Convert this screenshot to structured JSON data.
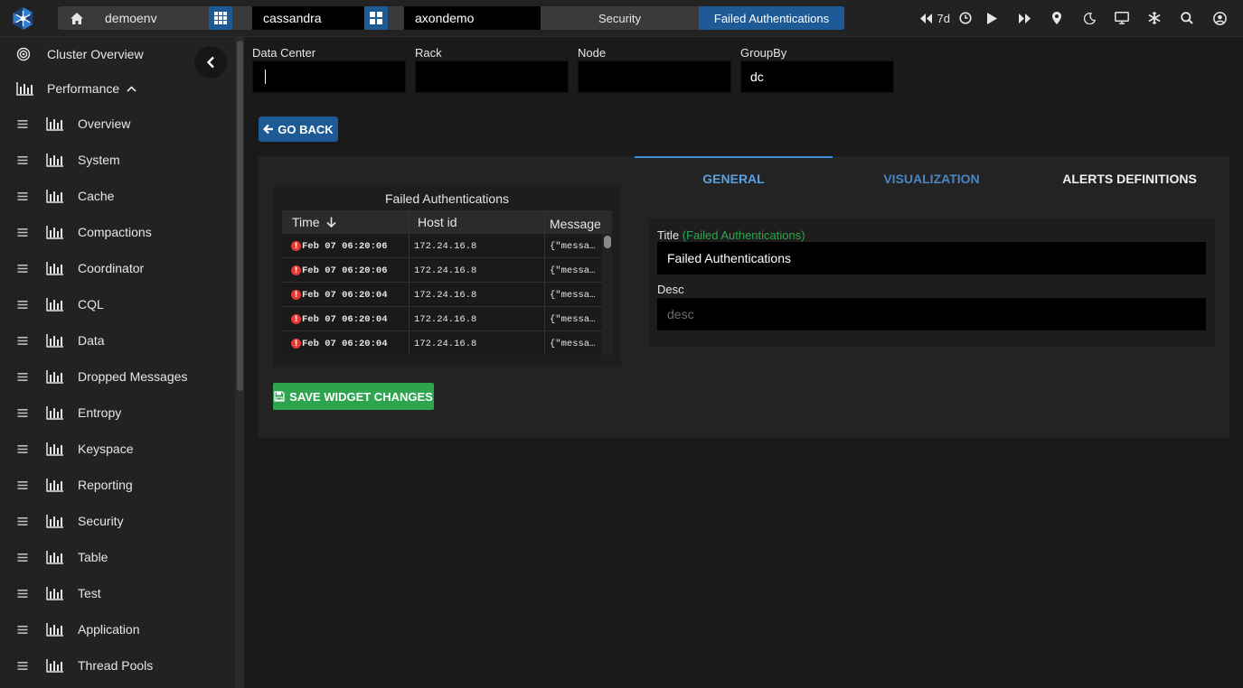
{
  "breadcrumb": {
    "env": "demoenv",
    "cluster": "cassandra",
    "org": "axondemo",
    "section": "Security",
    "active": "Failed Authentications"
  },
  "toolbar": {
    "range": "7d"
  },
  "sidebar": {
    "cluster_overview": "Cluster Overview",
    "performance": "Performance",
    "items": [
      {
        "label": "Overview"
      },
      {
        "label": "System"
      },
      {
        "label": "Cache"
      },
      {
        "label": "Compactions"
      },
      {
        "label": "Coordinator"
      },
      {
        "label": "CQL"
      },
      {
        "label": "Data"
      },
      {
        "label": "Dropped Messages"
      },
      {
        "label": "Entropy"
      },
      {
        "label": "Keyspace"
      },
      {
        "label": "Reporting"
      },
      {
        "label": "Security"
      },
      {
        "label": "Table"
      },
      {
        "label": "Test"
      },
      {
        "label": "Application"
      },
      {
        "label": "Thread Pools"
      }
    ]
  },
  "filters": {
    "data_center_label": "Data Center",
    "data_center_value": "",
    "rack_label": "Rack",
    "rack_value": "",
    "node_label": "Node",
    "node_value": "",
    "groupby_label": "GroupBy",
    "groupby_value": "dc"
  },
  "go_back_label": "GO BACK",
  "widget": {
    "title": "Failed Authentications",
    "columns": [
      "Time",
      "Host id",
      "Message"
    ],
    "rows": [
      {
        "time": "Feb 07 06:20:06",
        "host": "172.24.16.8",
        "message": "{\"messa…"
      },
      {
        "time": "Feb 07 06:20:06",
        "host": "172.24.16.8",
        "message": "{\"messa…"
      },
      {
        "time": "Feb 07 06:20:04",
        "host": "172.24.16.8",
        "message": "{\"messa…"
      },
      {
        "time": "Feb 07 06:20:04",
        "host": "172.24.16.8",
        "message": "{\"messa…"
      },
      {
        "time": "Feb 07 06:20:04",
        "host": "172.24.16.8",
        "message": "{\"messa…"
      }
    ]
  },
  "save_label": "SAVE WIDGET CHANGES",
  "tabs": {
    "general": "GENERAL",
    "visualization": "VISUALIZATION",
    "alerts": "ALERTS DEFINITIONS"
  },
  "form": {
    "title_label": "Title",
    "title_hint": "(Failed Authentications)",
    "title_value": "Failed Authentications",
    "desc_label": "Desc",
    "desc_placeholder": "desc"
  },
  "colors": {
    "accent": "#1e5b96",
    "tab_active": "#3d8fd9",
    "tab_link": "#4a90d9",
    "save": "#2ea44f",
    "error": "#e53935"
  }
}
